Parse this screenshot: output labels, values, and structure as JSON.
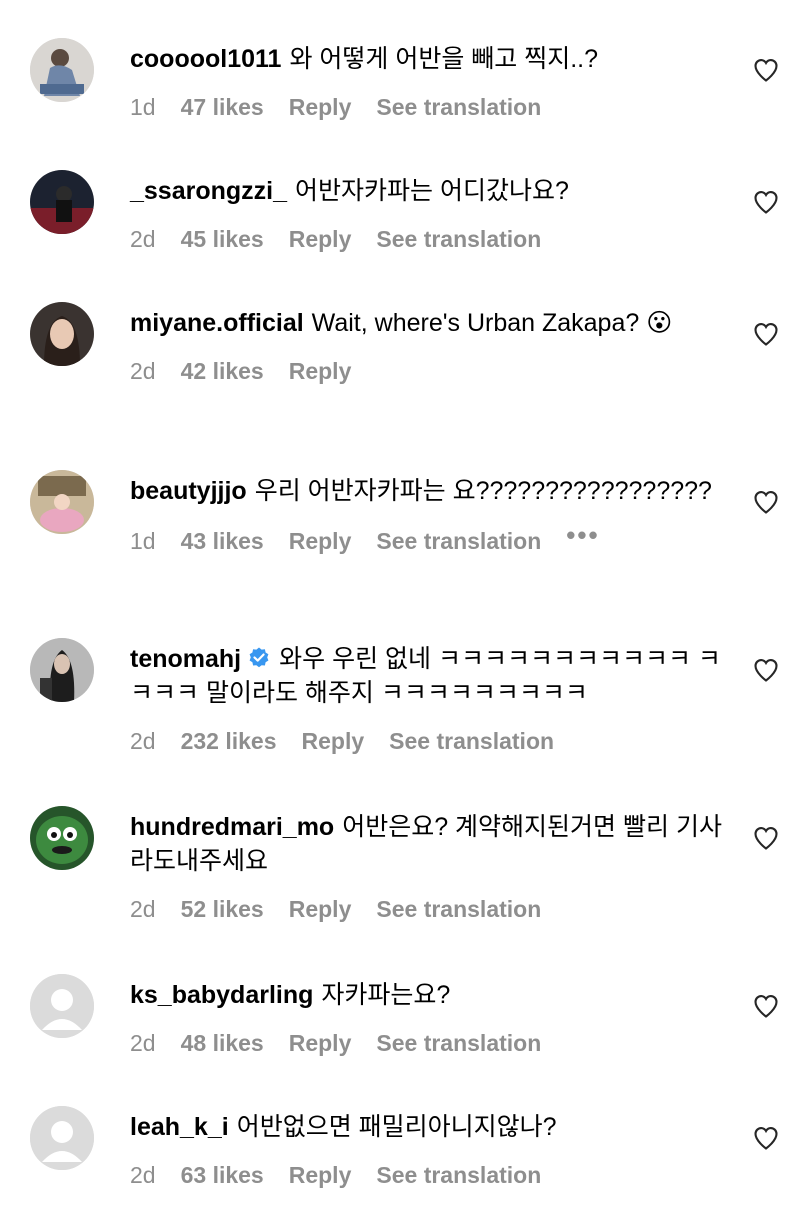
{
  "colors": {
    "meta": "#8e8e8e",
    "verified": "#3897f0"
  },
  "comments": [
    {
      "username": "coooool1011",
      "text": "와 어떻게 어반을 빼고 찍지..?",
      "time": "1d",
      "likes": "47 likes",
      "reply": "Reply",
      "translation": "See translation"
    },
    {
      "username": "_ssarongzzi_",
      "text": "어반자카파는 어디갔나요?",
      "time": "2d",
      "likes": "45 likes",
      "reply": "Reply",
      "translation": "See translation"
    },
    {
      "username": "miyane.official",
      "text": "Wait, where's Urban Zakapa? 😮",
      "time": "2d",
      "likes": "42 likes",
      "reply": "Reply"
    },
    {
      "username": "beautyjjjo",
      "text": "우리 어반자카파는 요?????????????????",
      "time": "1d",
      "likes": "43 likes",
      "reply": "Reply",
      "translation": "See translation",
      "more": "•••"
    },
    {
      "username": "tenomahj",
      "text": "와우 우린 없네 ㅋㅋㅋㅋㅋㅋㅋㅋㅋㅋㅋ ㅋㅋㅋㅋ 말이라도 해주지 ㅋㅋㅋㅋㅋㅋㅋㅋㅋ",
      "time": "2d",
      "likes": "232 likes",
      "reply": "Reply",
      "translation": "See translation"
    },
    {
      "username": "hundredmari_mo",
      "text": "어반은요? 계약해지된거면 빨리 기사라도내주세요",
      "time": "2d",
      "likes": "52 likes",
      "reply": "Reply",
      "translation": "See translation"
    },
    {
      "username": "ks_babydarling",
      "text": "자카파는요?",
      "time": "2d",
      "likes": "48 likes",
      "reply": "Reply",
      "translation": "See translation"
    },
    {
      "username": "leah_k_i",
      "text": "어반없으면 패밀리아니지않나?",
      "time": "2d",
      "likes": "63 likes",
      "reply": "Reply",
      "translation": "See translation"
    }
  ]
}
